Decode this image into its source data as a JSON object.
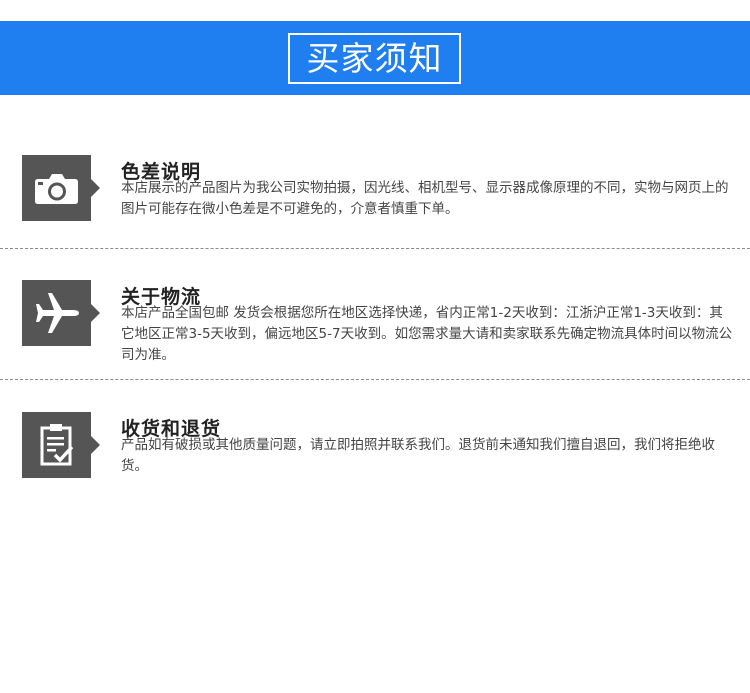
{
  "banner": {
    "title": "买家须知"
  },
  "sections": [
    {
      "icon": "camera-icon",
      "title": "色差说明",
      "description": "本店展示的产品图片为我公司实物拍摄，因光线、相机型号、显示器成像原理的不同，实物与网页上的图片可能存在微小色差是不可避免的，介意者慎重下单。"
    },
    {
      "icon": "airplane-icon",
      "title": "关于物流",
      "description": "本店产品全国包邮 发货会根据您所在地区选择快递，省内正常1-2天收到：江浙沪正常1-3天收到：其它地区正常3-5天收到，偏远地区5-7天收到。如您需求量大请和卖家联系先确定物流具体时间以物流公司为准。"
    },
    {
      "icon": "clipboard-check-icon",
      "title": "收货和退货",
      "description": "产品如有破损或其他质量问题，请立即拍照并联系我们。退货前未通知我们擅自退回，我们将拒绝收货。"
    }
  ],
  "colors": {
    "banner": "#1f7ef0",
    "icon_bg": "#555555",
    "icon_fg": "#ffffff"
  }
}
